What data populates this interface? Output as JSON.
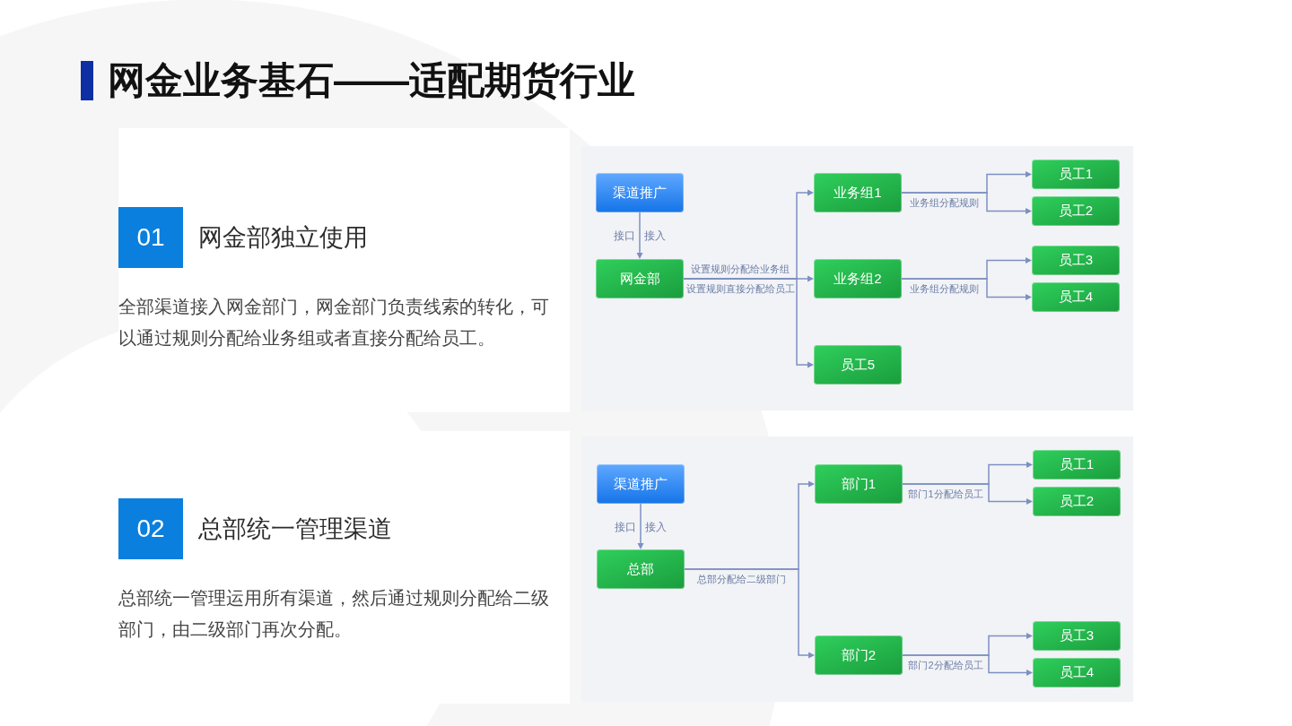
{
  "title": "网金业务基石——适配期货行业",
  "sections": [
    {
      "number": "01",
      "heading": "网金部独立使用",
      "description": "全部渠道接入网金部门，网金部门负责线索的转化，可以通过规则分配给业务组或者直接分配给员工。",
      "diagram": {
        "root": {
          "label": "渠道推广",
          "kind": "source",
          "edge_labels": [
            "接口",
            "接入"
          ],
          "children": [
            {
              "label": "网金部",
              "kind": "unit",
              "edge_labels": [
                "设置规则分配给业务组",
                "设置规则直接分配给员工"
              ],
              "children": [
                {
                  "label": "业务组1",
                  "kind": "unit",
                  "edge_labels": [
                    "业务组分配规则"
                  ],
                  "children": [
                    {
                      "label": "员工1",
                      "kind": "unit"
                    },
                    {
                      "label": "员工2",
                      "kind": "unit"
                    }
                  ]
                },
                {
                  "label": "业务组2",
                  "kind": "unit",
                  "edge_labels": [
                    "业务组分配规则"
                  ],
                  "children": [
                    {
                      "label": "员工3",
                      "kind": "unit"
                    },
                    {
                      "label": "员工4",
                      "kind": "unit"
                    }
                  ]
                },
                {
                  "label": "员工5",
                  "kind": "unit"
                }
              ]
            }
          ]
        }
      }
    },
    {
      "number": "02",
      "heading": "总部统一管理渠道",
      "description": "总部统一管理运用所有渠道，然后通过规则分配给二级部门，由二级部门再次分配。",
      "diagram": {
        "root": {
          "label": "渠道推广",
          "kind": "source",
          "edge_labels": [
            "接口",
            "接入"
          ],
          "children": [
            {
              "label": "总部",
              "kind": "unit",
              "edge_labels": [
                "总部分配给二级部门"
              ],
              "children": [
                {
                  "label": "部门1",
                  "kind": "unit",
                  "edge_labels": [
                    "部门1分配给员工"
                  ],
                  "children": [
                    {
                      "label": "员工1",
                      "kind": "unit"
                    },
                    {
                      "label": "员工2",
                      "kind": "unit"
                    }
                  ]
                },
                {
                  "label": "部门2",
                  "kind": "unit",
                  "edge_labels": [
                    "部门2分配给员工"
                  ],
                  "children": [
                    {
                      "label": "员工3",
                      "kind": "unit"
                    },
                    {
                      "label": "员工4",
                      "kind": "unit"
                    }
                  ]
                }
              ]
            }
          ]
        }
      }
    }
  ]
}
